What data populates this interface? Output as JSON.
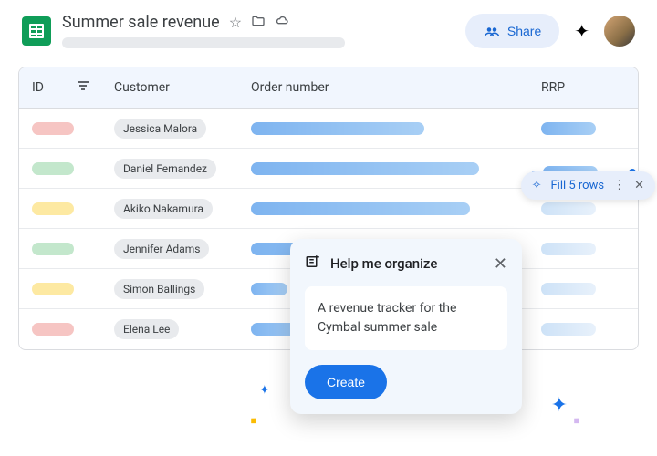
{
  "header": {
    "doc_title": "Summer sale revenue",
    "share_label": "Share"
  },
  "table": {
    "columns": {
      "id": "ID",
      "customer": "Customer",
      "order": "Order number",
      "rrp": "RRP"
    },
    "rows": [
      {
        "id_color": "red",
        "customer": "Jessica Malora"
      },
      {
        "id_color": "green",
        "customer": "Daniel Fernandez"
      },
      {
        "id_color": "yellow",
        "customer": "Akiko Nakamura"
      },
      {
        "id_color": "green",
        "customer": "Jennifer Adams"
      },
      {
        "id_color": "yellow",
        "customer": "Simon Ballings"
      },
      {
        "id_color": "red",
        "customer": "Elena Lee"
      }
    ]
  },
  "fill_chip": {
    "label": "Fill 5 rows"
  },
  "organize": {
    "title": "Help me organize",
    "prompt": "A revenue tracker for the Cymbal summer sale",
    "create_label": "Create"
  }
}
